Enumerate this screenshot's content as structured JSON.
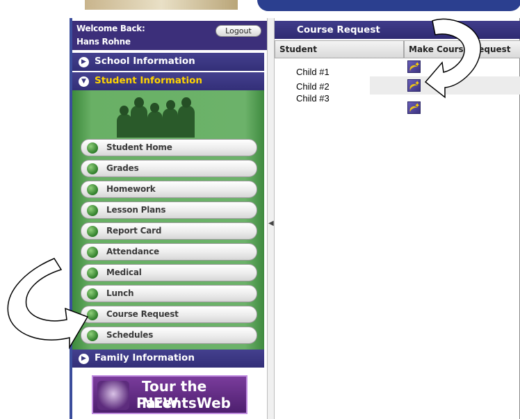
{
  "header": {
    "welcome_label": "Welcome Back:",
    "user_name": "Hans Rohne",
    "logout_label": "Logout"
  },
  "sidebar": {
    "sections": [
      {
        "label": "School Information",
        "icon": "chevron-right-icon"
      },
      {
        "label": "Student Information",
        "icon": "chevron-down-icon"
      },
      {
        "label": "Family Information",
        "icon": "chevron-right-icon"
      }
    ],
    "menu_items": [
      {
        "label": "Student Home"
      },
      {
        "label": "Grades"
      },
      {
        "label": "Homework"
      },
      {
        "label": "Lesson Plans"
      },
      {
        "label": "Report Card"
      },
      {
        "label": "Attendance"
      },
      {
        "label": "Medical"
      },
      {
        "label": "Lunch"
      },
      {
        "label": "Course Request"
      },
      {
        "label": "Schedules"
      }
    ],
    "tour": {
      "line1": "Tour the NEW",
      "line2": "ParentsWeb"
    }
  },
  "main": {
    "title": "Course Request",
    "columns": [
      "Student",
      "Make Course Request"
    ],
    "rows": [
      {
        "student": "Child #1",
        "icon": "course-request-icon"
      },
      {
        "student": "Child #2",
        "icon": "course-request-icon"
      },
      {
        "student": "Child #3",
        "icon": "course-request-icon"
      }
    ]
  },
  "colors": {
    "header_purple": "#3c2f7a",
    "section_blue": "#3b377f",
    "active_section_text": "#ffd400",
    "menu_green": "#6cb26a"
  }
}
